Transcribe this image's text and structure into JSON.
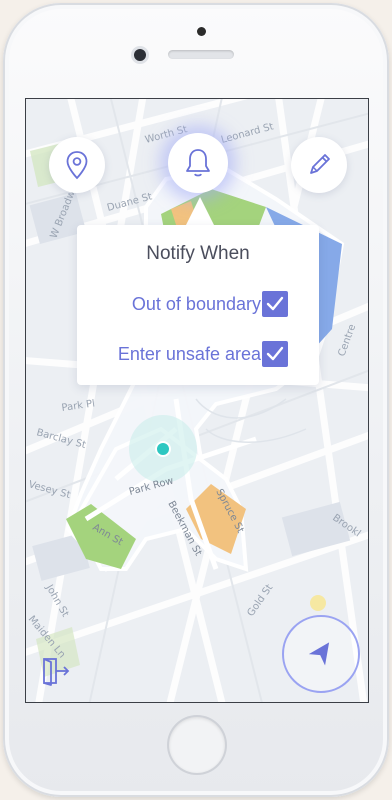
{
  "popup": {
    "title": "Notify When",
    "options": [
      {
        "label": "Out of boundary",
        "checked": true
      },
      {
        "label": "Enter unsafe area",
        "checked": true
      }
    ]
  },
  "map": {
    "street_labels": [
      "Leonard St",
      "W Broadway",
      "Duane St",
      "Worth St",
      "Park Pl",
      "Barclay St",
      "Vesey St",
      "Park Row",
      "Beekman St",
      "Ann St",
      "John St",
      "Maiden Ln",
      "Gold St",
      "Spruce St",
      "Centre",
      "Brookl"
    ]
  },
  "toolbar": {
    "location_icon": "map-pin-icon",
    "bell_icon": "bell-icon",
    "edit_icon": "pencil-icon",
    "locate_icon": "navigation-arrow-icon",
    "exit_icon": "exit-door-icon"
  },
  "colors": {
    "accent": "#6a73d8",
    "park_green": "#a4d37d",
    "zone_orange": "#f2c27f",
    "zone_blue": "#86a9e8",
    "user_dot": "#2ec7c1"
  }
}
